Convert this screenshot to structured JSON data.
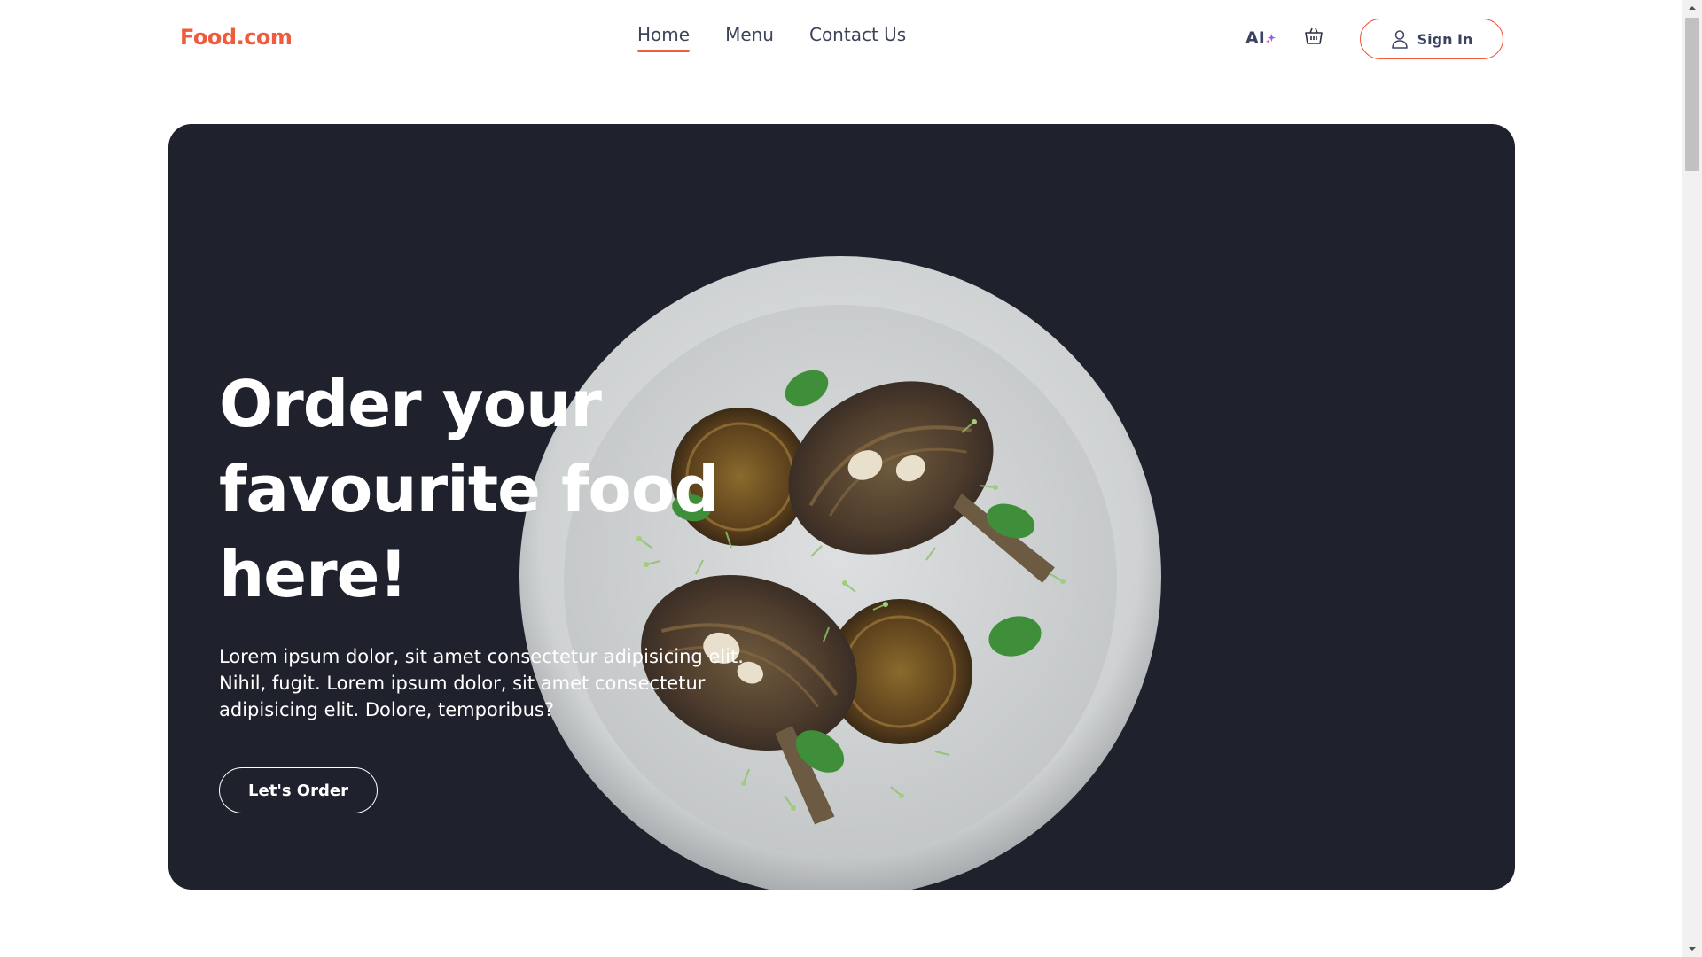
{
  "brand": {
    "logo_text": "Food.com",
    "accent_color": "#ef5b3e"
  },
  "nav": {
    "links": [
      {
        "label": "Home",
        "active": true
      },
      {
        "label": "Menu",
        "active": false
      },
      {
        "label": "Contact Us",
        "active": false
      }
    ]
  },
  "actions": {
    "ai_label": "AI",
    "ai_icon": "sparkle-icon",
    "basket_icon": "basket-icon",
    "signin_label": "Sign In",
    "signin_icon": "user-icon"
  },
  "hero": {
    "title": "Order your favourite food here!",
    "description": "Lorem ipsum dolor, sit amet consectetur adipisicing elit. Nihil, fugit. Lorem ipsum dolor, sit amet consectetur adipisicing elit. Dolore, temporibus?",
    "cta_label": "Let's Order",
    "background_color": "#1f222d",
    "image": "plate-of-grilled-artichokes"
  }
}
